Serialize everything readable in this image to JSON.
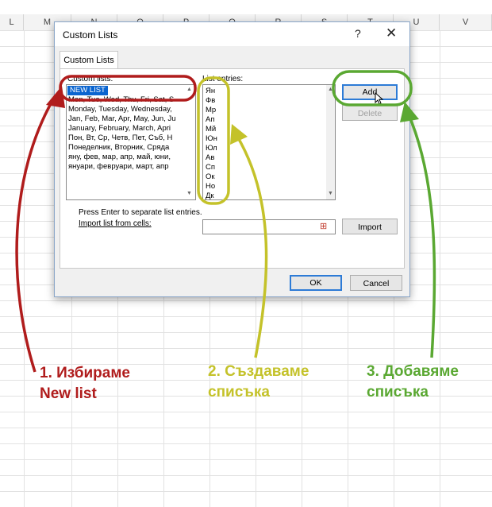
{
  "sheet": {
    "columns": [
      "L",
      "M",
      "N",
      "O",
      "P",
      "Q",
      "R",
      "S",
      "T",
      "U",
      "V"
    ]
  },
  "dialog": {
    "title": "Custom Lists",
    "help": "?",
    "close": "✕",
    "tab": "Custom Lists",
    "custom_lists_label": "Custom lists:",
    "list_entries_label": "List entries:",
    "custom_lists": [
      "NEW LIST",
      "Mon, Tue, Wed, Thu, Fri, Sat, S",
      "Monday, Tuesday, Wednesday,",
      "Jan, Feb, Mar, Apr, May, Jun, Ju",
      "January, February, March, Apri",
      "Пон, Вт, Ср, Четв, Пет, Съб, Н",
      "Понеделник, Вторник, Сряда",
      "яну, фев, мар, апр, май, юни,",
      "януари, февруари, март, апр"
    ],
    "entries": [
      "Ян",
      "Фв",
      "Мр",
      "Ап",
      "Мй",
      "Юн",
      "Юл",
      "Ав",
      "Сп",
      "Ок",
      "Но",
      "Дк"
    ],
    "add_label": "Add",
    "delete_label": "Delete",
    "hint": "Press Enter to separate list entries.",
    "import_label": "Import list from cells:",
    "import_button": "Import",
    "import_value": "",
    "ok_label": "OK",
    "cancel_label": "Cancel"
  },
  "annotations": {
    "step1": [
      "1. Избираме",
      "New list"
    ],
    "step2": [
      "2. Създаваме",
      "списъка"
    ],
    "step3": [
      "3. Добавяме",
      "списъка"
    ],
    "colors": {
      "red": "#b01c1c",
      "yellow": "#c4c22a",
      "green": "#5aa832"
    }
  }
}
